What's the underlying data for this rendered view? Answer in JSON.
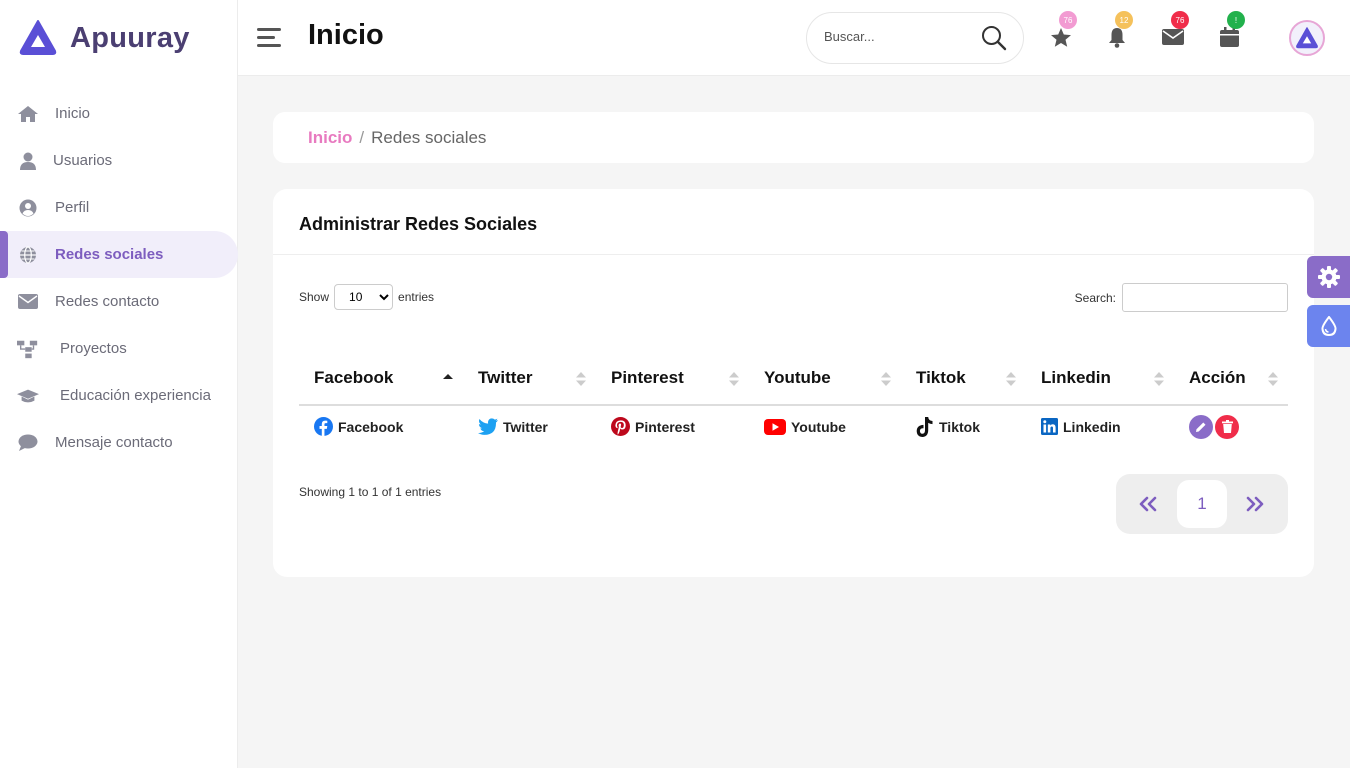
{
  "brand": {
    "name": "Apuuray"
  },
  "sidebar": {
    "items": [
      {
        "label": "Inicio",
        "icon": "home-icon"
      },
      {
        "label": "Usuarios",
        "icon": "user-icon"
      },
      {
        "label": "Perfil",
        "icon": "user-circle-icon"
      },
      {
        "label": "Redes sociales",
        "icon": "globe-icon",
        "active": true
      },
      {
        "label": "Redes contacto",
        "icon": "envelope-icon"
      },
      {
        "label": "Proyectos",
        "icon": "sitemap-icon"
      },
      {
        "label": "Educación experiencia",
        "icon": "graduation-cap-icon"
      },
      {
        "label": "Mensaje contacto",
        "icon": "comment-icon"
      }
    ]
  },
  "header": {
    "title": "Inicio",
    "search_placeholder": "Buscar...",
    "icons": [
      {
        "name": "star-icon",
        "badge": "76",
        "color": "#f29bd2"
      },
      {
        "name": "bell-icon",
        "badge": "12",
        "color": "#f5c15b"
      },
      {
        "name": "mail-icon",
        "badge": "76",
        "color": "#f02d4a"
      },
      {
        "name": "calendar-icon",
        "badge": "!",
        "color": "#22b14c"
      }
    ]
  },
  "breadcrumb": {
    "home": "Inicio",
    "separator": "/",
    "current": "Redes sociales"
  },
  "card": {
    "title": "Administrar Redes Sociales",
    "show_label": "Show",
    "entries_label": "entries",
    "page_size": "10",
    "search_label": "Search:",
    "columns": [
      "Facebook",
      "Twitter",
      "Pinterest",
      "Youtube",
      "Tiktok",
      "Linkedin",
      "Acción"
    ],
    "rows": [
      {
        "facebook": "Facebook",
        "twitter": "Twitter",
        "pinterest": "Pinterest",
        "youtube": "Youtube",
        "tiktok": "Tiktok",
        "linkedin": "Linkedin"
      }
    ],
    "info": "Showing 1 to 1 of 1 entries",
    "current_page": "1"
  },
  "colors": {
    "accent": "#7d5dbf",
    "pink": "#e87ac0",
    "facebook": "#1877f2",
    "twitter": "#1da1f2",
    "pinterest": "#bd081c",
    "youtube": "#ff0000",
    "linkedin": "#0a66c2",
    "edit": "#8a6cc8",
    "delete": "#f02d4a"
  }
}
